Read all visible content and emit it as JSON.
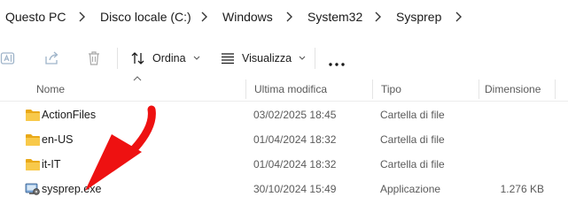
{
  "breadcrumb": [
    "Questo PC",
    "Disco locale (C:)",
    "Windows",
    "System32",
    "Sysprep"
  ],
  "toolbar": {
    "sort_label": "Ordina",
    "view_label": "Visualizza",
    "icons": [
      "rename-icon",
      "share-icon",
      "delete-icon",
      "sort-icon",
      "view-icon",
      "more-icon"
    ]
  },
  "columns": {
    "name": "Nome",
    "modified": "Ultima modifica",
    "type": "Tipo",
    "size": "Dimensione"
  },
  "files": [
    {
      "name": "ActionFiles",
      "modified": "03/02/2025 18:45",
      "type": "Cartella di file",
      "size": "",
      "icon": "folder-icon"
    },
    {
      "name": "en-US",
      "modified": "01/04/2024 18:32",
      "type": "Cartella di file",
      "size": "",
      "icon": "folder-icon"
    },
    {
      "name": "it-IT",
      "modified": "01/04/2024 18:32",
      "type": "Cartella di file",
      "size": "",
      "icon": "folder-icon"
    },
    {
      "name": "sysprep.exe",
      "modified": "30/10/2024 15:49",
      "type": "Applicazione",
      "size": "1.276 KB",
      "icon": "application-icon"
    }
  ],
  "colors": {
    "folder": "#f5c242",
    "annotation_arrow": "#ee1111",
    "text": "#1a1a1a",
    "muted": "#5a5a5a"
  }
}
